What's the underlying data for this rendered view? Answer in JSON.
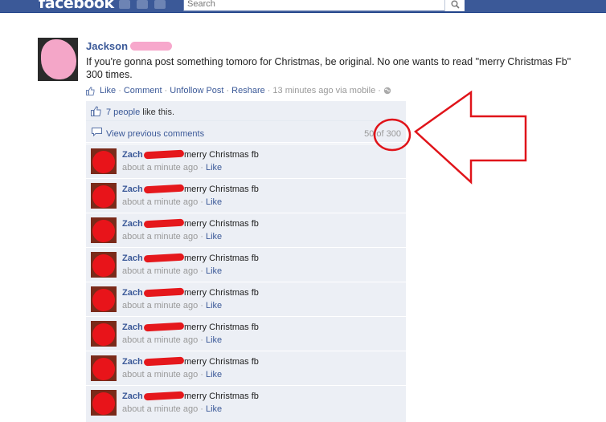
{
  "header": {
    "logo": "facebook",
    "search_placeholder": "Search",
    "jewels": [
      "friend-requests-icon",
      "messages-icon",
      "notifications-icon"
    ]
  },
  "post": {
    "author": "Jackson",
    "text": "If you're gonna post something tomoro for Christmas, be original. No one wants to read \"merry Christmas Fb\" 300 times.",
    "actions": {
      "like": "Like",
      "comment": "Comment",
      "unfollow": "Unfollow Post",
      "reshare": "Reshare",
      "time": "13 minutes ago via mobile",
      "separator": "·"
    }
  },
  "feedback": {
    "likes_count": "7 people",
    "likes_suffix": "like this.",
    "view_previous": "View previous comments",
    "comment_count": "50 of 300"
  },
  "comments": [
    {
      "name": "Zach",
      "text": "merry Christmas fb",
      "time": "about a minute ago",
      "like": "Like"
    },
    {
      "name": "Zach",
      "text": "merry Christmas fb",
      "time": "about a minute ago",
      "like": "Like"
    },
    {
      "name": "Zach",
      "text": "merry Christmas fb",
      "time": "about a minute ago",
      "like": "Like"
    },
    {
      "name": "Zach",
      "text": "merry Christmas fb",
      "time": "about a minute ago",
      "like": "Like"
    },
    {
      "name": "Zach",
      "text": "merry Christmas fb",
      "time": "about a minute ago",
      "like": "Like"
    },
    {
      "name": "Zach",
      "text": "merry Christmas fb",
      "time": "about a minute ago",
      "like": "Like"
    },
    {
      "name": "Zach",
      "text": "merry Christmas fb",
      "time": "about a minute ago",
      "like": "Like"
    },
    {
      "name": "Zach",
      "text": "merry Christmas fb",
      "time": "about a minute ago",
      "like": "Like"
    }
  ],
  "colors": {
    "brand": "#3b5998",
    "annotation": "#e0141a",
    "redaction_pink": "#f7a8cc",
    "redaction_red": "#e5181c"
  }
}
